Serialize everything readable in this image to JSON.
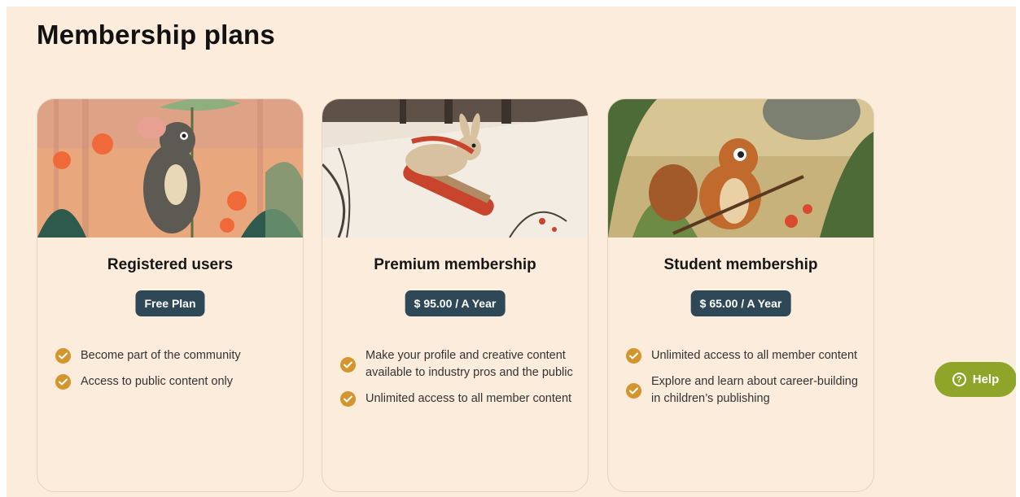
{
  "page": {
    "title": "Membership plans"
  },
  "plans": [
    {
      "title": "Registered users",
      "price": "Free Plan",
      "image_icon": "mouse-illustration",
      "features": [
        "Become part of the community",
        "Access to public content only"
      ]
    },
    {
      "title": "Premium membership",
      "price": "$ 95.00 / A Year",
      "image_icon": "rabbit-sled-illustration",
      "features": [
        "Make your profile and creative content available to industry pros and the public",
        "Unlimited access to all member content"
      ]
    },
    {
      "title": "Student membership",
      "price": "$ 65.00 / A Year",
      "image_icon": "chipmunk-illustration",
      "features": [
        "Unlimited access to all member content",
        "Explore and learn about career-building in children’s publishing"
      ]
    }
  ],
  "help": {
    "label": "Help",
    "icon": "question-circle-icon"
  },
  "colors": {
    "background": "#fbecdc",
    "badge": "#2f4858",
    "check": "#d4952f",
    "help_button": "#8ea52a"
  }
}
